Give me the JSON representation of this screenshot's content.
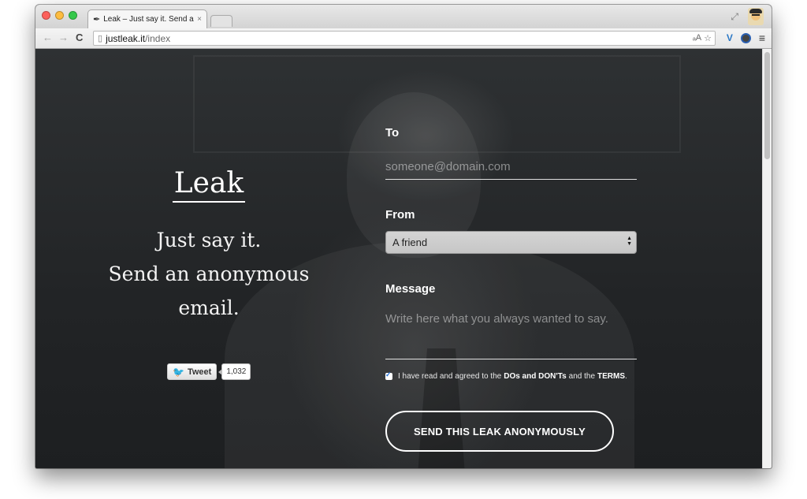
{
  "browser": {
    "tab_title": "Leak – Just say it. Send an",
    "tab_close": "×",
    "url_host": "justleak.it",
    "url_path": "/index"
  },
  "page": {
    "logo": "Leak",
    "tagline_1": "Just say it.",
    "tagline_2": "Send an anonymous",
    "tagline_3": "email.",
    "tweet_label": "Tweet",
    "tweet_count": "1,032"
  },
  "form": {
    "to_label": "To",
    "to_placeholder": "someone@domain.com",
    "from_label": "From",
    "from_value": "A friend",
    "message_label": "Message",
    "message_placeholder": "Write here what you always wanted to say.",
    "agree_text": "I have read and agreed to the",
    "agree_link_1": "DOs and DON'Ts",
    "agree_and": "and the",
    "agree_link_2": "TERMS",
    "agree_period": ".",
    "submit_label": "SEND THIS LEAK ANONYMOUSLY"
  },
  "colors": {
    "background": "#222426",
    "accent": "#ffffff",
    "checkbox": "#1e6fd9"
  },
  "icons": [
    "quill-icon",
    "page-icon",
    "translate-icon",
    "star-icon",
    "twitter-bird-icon",
    "menu-icon"
  ]
}
